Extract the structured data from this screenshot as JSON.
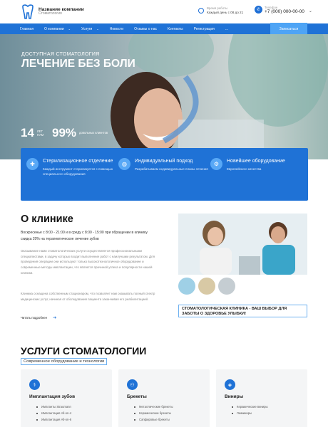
{
  "header": {
    "company_name": "Название компании",
    "company_sub": "Стоматология",
    "hours_label": "Время работы",
    "hours_value": "Каждый день с 08 до 21",
    "phone_label": "Телефон",
    "phone_value": "+7 (000) 000-00-00"
  },
  "nav": {
    "items": [
      "Главная",
      "О компании",
      "Услуги",
      "Новости",
      "Отзывы о нас",
      "Контакты",
      "Регистрация",
      "..."
    ],
    "cta": "Записаться"
  },
  "hero": {
    "kicker": "ДОСТУПНАЯ СТОМАТОЛОГИЯ",
    "title": "ЛЕЧЕНИЕ БЕЗ БОЛИ",
    "stat1_value": "14",
    "stat1_label": "ЛЕТ\nНАМ",
    "stat2_value": "99%",
    "stat2_label": "довольных клиентов"
  },
  "features": [
    {
      "title": "Стерилизационное отделение",
      "desc": "Каждый инструмент стерилизуется с помощью специального оборудования",
      "icon": "sterilization-icon"
    },
    {
      "title": "Индивидуальный подход",
      "desc": "Разрабатываем индивидуальные планы лечения",
      "icon": "individual-icon"
    },
    {
      "title": "Новейшее оборудование",
      "desc": "Европейского качества",
      "icon": "equipment-icon"
    }
  ],
  "about": {
    "title": "О клинике",
    "p1": "Воскресенье с 8:00 - 21:00 и в среду с 8:00 - 15:00 при обращении в клинику скидка 20% на терапевтическое лечение зубов",
    "p2": "Оказывание нами стоматологических услуги осуществляется профессиональными специалистами, в задачу которых входит выполнение работ с наилучшим результатом. Для проведения операции они используют только высокотехнологичное оборудование и современные методы имплантации, что является причиной успеха и популярности нашей клиники.",
    "p3": "Клиника оснащена собственным стационаром, что позволяет нам оказывать полный спектр медицинских услуг, начиная от обследования пациента заканчивая его реабилитацией.",
    "more": "Читать подробнее",
    "promo": "СТОМАТОЛОГИЧЕСКАЯ КЛИНИКА - ВАШ ВЫБОР ДЛЯ ЗАБОТЫ О ЗДОРОВЬЕ УЛЫБКИ!"
  },
  "services": {
    "title": "УСЛУГИ СТОМАТОЛОГИИ",
    "subtitle": "Современное оборудование и технологии",
    "cards": [
      {
        "title": "Имплантация зубов",
        "items": [
          "Импланты Straumann",
          "Имплантация All-on-4",
          "Имплантация All-on-6"
        ]
      },
      {
        "title": "Брекеты",
        "items": [
          "Металлические брекеты",
          "Керамические брекеты",
          "Сапфировые брекеты"
        ]
      },
      {
        "title": "Виниры",
        "items": [
          "Керамические виниры",
          "Люминиры"
        ]
      }
    ]
  },
  "colors": {
    "accent": "#1f72d6",
    "light_accent": "#4ea4f5"
  }
}
